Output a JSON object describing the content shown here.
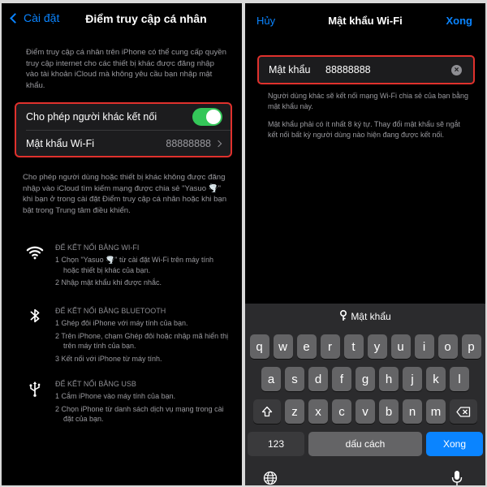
{
  "left": {
    "back_label": "Cài đặt",
    "title": "Điểm truy cập cá nhân",
    "intro": "Điểm truy cập cá nhân trên iPhone có thể cung cấp quyền truy cập internet cho các thiết bị khác được đăng nhập vào tài khoản iCloud mà không yêu cầu bạn nhập mật khẩu.",
    "allow_label": "Cho phép người khác kết nối",
    "allow_toggle": "on",
    "wifi_password_label": "Mật khẩu Wi-Fi",
    "wifi_password_value": "88888888",
    "description": "Cho phép người dùng hoặc thiết bị khác không được đăng nhập vào iCloud tìm kiếm mạng được chia sẻ \"Yasuo 🌪️\" khi bạn ở trong cài đặt Điểm truy cập cá nhân hoặc khi bạn bật trong Trung tâm điều khiển.",
    "sections": [
      {
        "icon": "wifi-icon",
        "title": "ĐỂ KẾT NỐI BẰNG WI-FI",
        "steps": [
          "1 Chọn \"Yasuo 🌪️\" từ cài đặt Wi-Fi trên máy tính hoặc thiết bị khác của bạn.",
          "2 Nhập mật khẩu khi được nhắc."
        ]
      },
      {
        "icon": "bluetooth-icon",
        "title": "ĐỂ KẾT NỐI BẰNG BLUETOOTH",
        "steps": [
          "1 Ghép đôi iPhone với máy tính của bạn.",
          "2 Trên iPhone, chạm Ghép đôi hoặc nhập mã hiển thị trên máy tính của bạn.",
          "3 Kết nối với iPhone từ máy tính."
        ]
      },
      {
        "icon": "usb-icon",
        "title": "ĐỂ KẾT NỐI BẰNG USB",
        "steps": [
          "1 Cắm iPhone vào máy tính của bạn.",
          "2 Chọn iPhone từ danh sách dịch vụ mạng trong cài đặt của bạn."
        ]
      }
    ]
  },
  "right": {
    "cancel_label": "Hủy",
    "title": "Mật khẩu Wi-Fi",
    "done_label": "Xong",
    "password_label": "Mật khẩu",
    "password_value": "88888888",
    "note1": "Người dùng khác sẽ kết nối mạng Wi-Fi chia sẻ của bạn bằng mật khẩu này.",
    "note2": "Mật khẩu phải có ít nhất 8 ký tự. Thay đổi mật khẩu sẽ ngắt kết nối bất kỳ người dùng nào hiện đang được kết nối.",
    "keyboard": {
      "suggestion": "Mật khẩu",
      "row1": [
        "q",
        "w",
        "e",
        "r",
        "t",
        "y",
        "u",
        "i",
        "o",
        "p"
      ],
      "row2": [
        "a",
        "s",
        "d",
        "f",
        "g",
        "h",
        "j",
        "k",
        "l"
      ],
      "row3": [
        "z",
        "x",
        "c",
        "v",
        "b",
        "n",
        "m"
      ],
      "numbers_label": "123",
      "space_label": "dấu cách",
      "return_label": "Xong"
    }
  },
  "colors": {
    "accent": "#0a84ff",
    "toggle_on": "#34c759",
    "highlight": "#e0312d"
  }
}
